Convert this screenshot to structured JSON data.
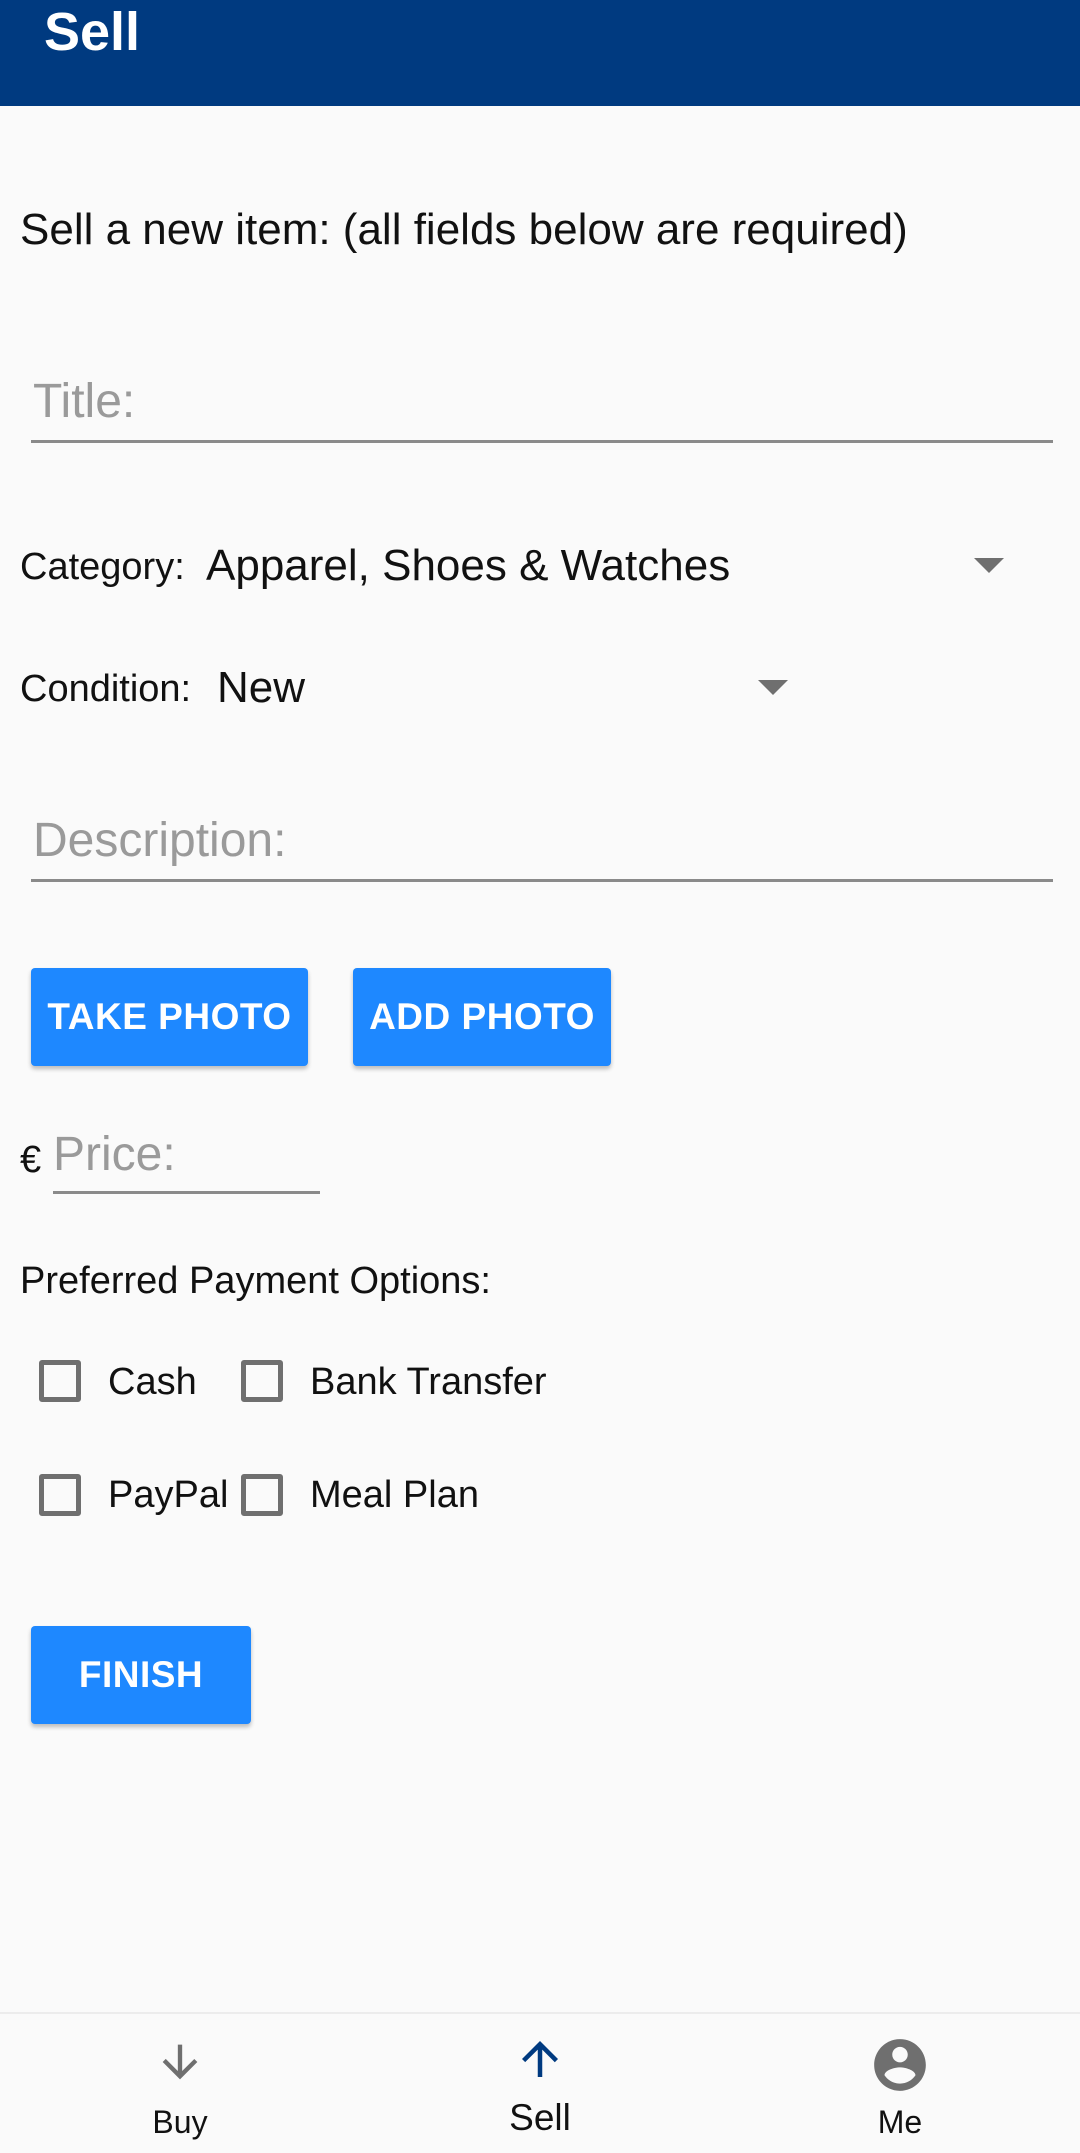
{
  "appbar": {
    "title": "Sell"
  },
  "form": {
    "heading": "Sell a new item: (all fields below are required)",
    "title_placeholder": "Title:",
    "category_label": "Category:",
    "category_value": "Apparel, Shoes & Watches",
    "condition_label": "Condition:",
    "condition_value": "New",
    "description_placeholder": "Description:",
    "take_photo_label": "TAKE PHOTO",
    "add_photo_label": "ADD PHOTO",
    "currency_symbol": "€",
    "price_placeholder": "Price:",
    "payment_label": "Preferred Payment Options:",
    "payment_options": [
      {
        "label": "Cash",
        "checked": false
      },
      {
        "label": "Bank Transfer",
        "checked": false
      },
      {
        "label": "PayPal",
        "checked": false
      },
      {
        "label": "Meal Plan",
        "checked": false
      }
    ],
    "finish_label": "FINISH"
  },
  "bottom_nav": {
    "items": [
      {
        "label": "Buy",
        "icon": "arrow-down-icon",
        "active": false
      },
      {
        "label": "Sell",
        "icon": "arrow-up-icon",
        "active": true
      },
      {
        "label": "Me",
        "icon": "account-circle-icon",
        "active": false
      }
    ]
  },
  "colors": {
    "appbar": "#003a80",
    "button": "#1e88ff",
    "active_nav_icon": "#003a80",
    "inactive_nav_icon": "#6f6f6f"
  }
}
